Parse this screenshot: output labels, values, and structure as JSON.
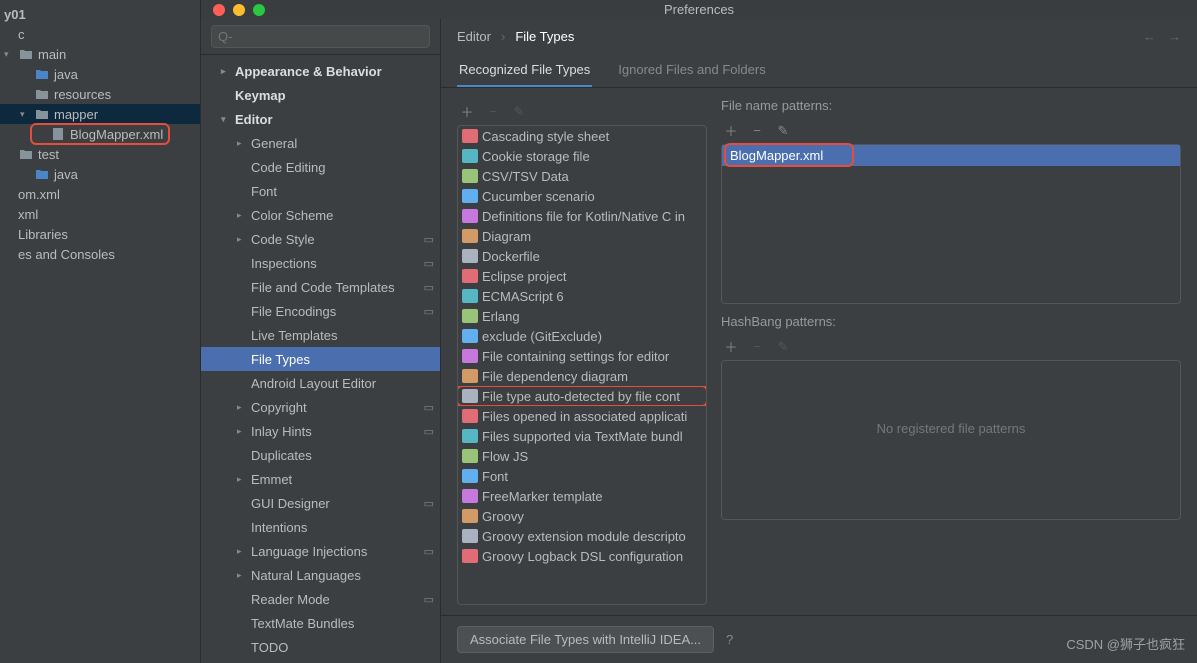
{
  "project_tree": {
    "root_suffix": "y01",
    "items": [
      {
        "label": "c",
        "indent": 0,
        "folder": false
      },
      {
        "label": "main",
        "indent": 0,
        "folder": true,
        "blue": false,
        "arrow": "down"
      },
      {
        "label": "java",
        "indent": 1,
        "folder": true,
        "blue": true
      },
      {
        "label": "resources",
        "indent": 1,
        "folder": true,
        "blue": false
      },
      {
        "label": "mapper",
        "indent": 1,
        "folder": true,
        "blue": false,
        "arrow": "down",
        "selected": true
      },
      {
        "label": "BlogMapper.xml",
        "indent": 2,
        "folder": false,
        "file": true,
        "highlight": true
      },
      {
        "label": "test",
        "indent": 0,
        "folder": true,
        "blue": false
      },
      {
        "label": "java",
        "indent": 1,
        "folder": true,
        "blue": true
      },
      {
        "label": "om.xml",
        "indent": 0,
        "folder": false
      },
      {
        "label": "xml",
        "indent": 0,
        "folder": false
      },
      {
        "label": "Libraries",
        "indent": 0,
        "folder": false
      },
      {
        "label": "es and Consoles",
        "indent": 0,
        "folder": false
      }
    ]
  },
  "dialog": {
    "title": "Preferences",
    "search_placeholder": "Q-",
    "breadcrumb": [
      "Editor",
      "File Types"
    ],
    "tabs": [
      "Recognized File Types",
      "Ignored Files and Folders"
    ],
    "active_tab": 0
  },
  "sidebar": [
    {
      "label": "Appearance & Behavior",
      "bold": true,
      "arrow": "right",
      "indent": 0
    },
    {
      "label": "Keymap",
      "bold": true,
      "indent": 0
    },
    {
      "label": "Editor",
      "bold": true,
      "arrow": "down",
      "indent": 0
    },
    {
      "label": "General",
      "arrow": "right",
      "indent": 1
    },
    {
      "label": "Code Editing",
      "indent": 1
    },
    {
      "label": "Font",
      "indent": 1
    },
    {
      "label": "Color Scheme",
      "arrow": "right",
      "indent": 1
    },
    {
      "label": "Code Style",
      "arrow": "right",
      "indent": 1,
      "gear": true
    },
    {
      "label": "Inspections",
      "indent": 1,
      "gear": true
    },
    {
      "label": "File and Code Templates",
      "indent": 1,
      "gear": true
    },
    {
      "label": "File Encodings",
      "indent": 1,
      "gear": true
    },
    {
      "label": "Live Templates",
      "indent": 1
    },
    {
      "label": "File Types",
      "indent": 1,
      "selected": true
    },
    {
      "label": "Android Layout Editor",
      "indent": 1
    },
    {
      "label": "Copyright",
      "arrow": "right",
      "indent": 1,
      "gear": true
    },
    {
      "label": "Inlay Hints",
      "arrow": "right",
      "indent": 1,
      "gear": true
    },
    {
      "label": "Duplicates",
      "indent": 1
    },
    {
      "label": "Emmet",
      "arrow": "right",
      "indent": 1
    },
    {
      "label": "GUI Designer",
      "indent": 1,
      "gear": true
    },
    {
      "label": "Intentions",
      "indent": 1
    },
    {
      "label": "Language Injections",
      "arrow": "right",
      "indent": 1,
      "gear": true
    },
    {
      "label": "Natural Languages",
      "arrow": "right",
      "indent": 1
    },
    {
      "label": "Reader Mode",
      "indent": 1,
      "gear": true
    },
    {
      "label": "TextMate Bundles",
      "indent": 1
    },
    {
      "label": "TODO",
      "indent": 1
    }
  ],
  "file_types": [
    "Cascading style sheet",
    "Cookie storage file",
    "CSV/TSV Data",
    "Cucumber scenario",
    "Definitions file for Kotlin/Native C in",
    "Diagram",
    "Dockerfile",
    "Eclipse project",
    "ECMAScript 6",
    "Erlang",
    "exclude (GitExclude)",
    "File containing settings for editor",
    "File dependency diagram",
    "File type auto-detected by file cont",
    "Files opened in associated applicati",
    "Files supported via TextMate bundl",
    "Flow JS",
    "Font",
    "FreeMarker template",
    "Groovy",
    "Groovy extension module descripto",
    "Groovy Logback DSL configuration"
  ],
  "file_types_highlight_index": 13,
  "filename_patterns": {
    "label": "File name patterns:",
    "items": [
      "BlogMapper.xml"
    ]
  },
  "hashbang": {
    "label": "HashBang patterns:",
    "empty_text": "No registered file patterns"
  },
  "footer": {
    "associate_button": "Associate File Types with IntelliJ IDEA..."
  },
  "watermark": "CSDN @狮子也疯狂",
  "icon_colors": [
    "#e06c75",
    "#56b6c2",
    "#98c379",
    "#61afef",
    "#c678dd",
    "#d19a66",
    "#abb2bf"
  ]
}
